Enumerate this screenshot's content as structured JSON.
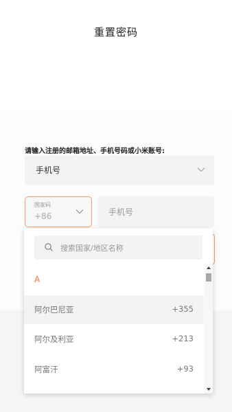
{
  "page": {
    "title": "重置密码"
  },
  "form": {
    "prompt_label": "请输入注册的邮箱地址、手机号码或小米账号:",
    "account_type": {
      "selected": "手机号"
    },
    "country_code": {
      "label": "国家码",
      "value": "+86"
    },
    "phone": {
      "placeholder": "手机号",
      "value": ""
    }
  },
  "country_dropdown": {
    "search_placeholder": "搜索国家/地区名称",
    "group_letter": "A",
    "countries": [
      {
        "name": "阿尔巴尼亚",
        "code": "+355",
        "selected": true
      },
      {
        "name": "阿尔及利亚",
        "code": "+213",
        "selected": false
      },
      {
        "name": "阿富汗",
        "code": "+93",
        "selected": false
      }
    ]
  },
  "colors": {
    "accent": "#ee7a3a",
    "focus_border": "#f0a070",
    "field_bg": "#f3f3f3"
  },
  "icons": {
    "account_chevron": "chevron-down-icon",
    "country_chevron": "chevron-down-icon",
    "search": "search-icon"
  }
}
